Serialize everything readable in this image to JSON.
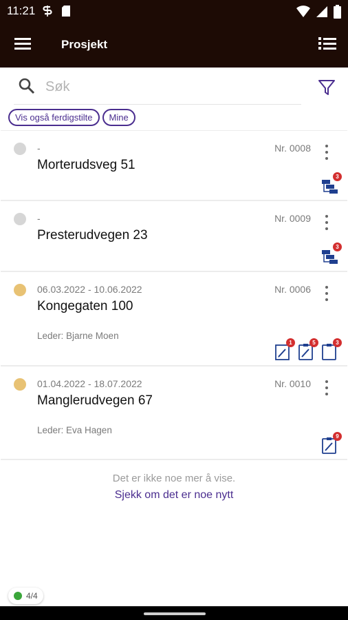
{
  "statusbar": {
    "time": "11:21"
  },
  "appbar": {
    "title": "Prosjekt"
  },
  "search": {
    "placeholder": "Søk"
  },
  "chips": [
    {
      "label": "Vis også ferdigstilte"
    },
    {
      "label": "Mine"
    }
  ],
  "colors": {
    "accent": "#4a2d8f",
    "appbar": "#1d0b05",
    "status_grey": "#d6d6d6",
    "status_yellow": "#e8c274",
    "badge": "#d32f2f"
  },
  "projects": [
    {
      "dates": "-",
      "nr": "Nr. 0008",
      "name": "Morterudsveg 51",
      "leader": "",
      "status": "grey",
      "icons": [
        {
          "icon": "gantt-icon",
          "badge": "3"
        }
      ]
    },
    {
      "dates": "-",
      "nr": "Nr. 0009",
      "name": "Presterudvegen 23",
      "leader": "",
      "status": "grey",
      "icons": [
        {
          "icon": "gantt-icon",
          "badge": "3"
        }
      ]
    },
    {
      "dates": "06.03.2022 - 10.06.2022",
      "nr": "Nr. 0006",
      "name": "Kongegaten 100",
      "leader": "Leder: Bjarne Moen",
      "status": "yellow",
      "icons": [
        {
          "icon": "edit-doc-icon",
          "badge": "1"
        },
        {
          "icon": "edit-clipboard-icon",
          "badge": "5"
        },
        {
          "icon": "clipboard-icon",
          "badge": "3"
        }
      ]
    },
    {
      "dates": "01.04.2022 - 18.07.2022",
      "nr": "Nr. 0010",
      "name": "Manglerudvegen 67",
      "leader": "Leder: Eva Hagen",
      "status": "yellow",
      "icons": [
        {
          "icon": "edit-clipboard-icon",
          "badge": "9"
        }
      ]
    }
  ],
  "footer": {
    "empty_text": "Det er ikke noe mer å vise.",
    "refresh_link": "Sjekk om det er noe nytt"
  },
  "sync": {
    "count": "4/4"
  }
}
